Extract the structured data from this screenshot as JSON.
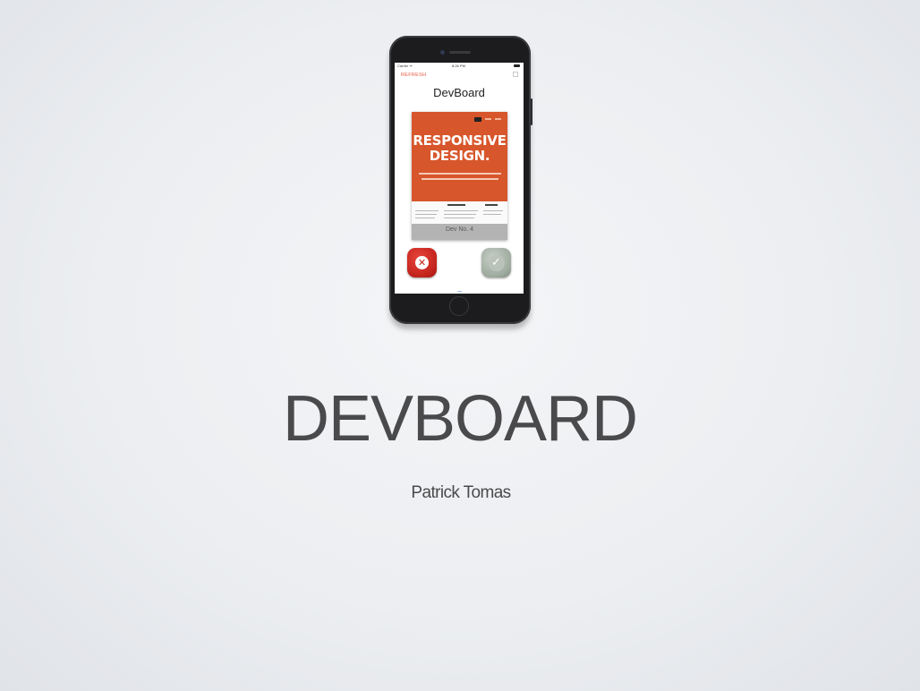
{
  "slide": {
    "title": "DEVBOARD",
    "subtitle": "Patrick Tomas"
  },
  "phone_app": {
    "status_bar": {
      "carrier": "Carrier ᯤ",
      "time": "8:26 PM"
    },
    "refresh_label": "REFRESH",
    "compose_icon": "compose-icon",
    "app_title": "DevBoard",
    "card": {
      "hero_title": "RESPONSIVE DESIGN.",
      "footer_label": "Dev No. 4"
    },
    "reject_icon": "close-icon",
    "reject_glyph": "✕",
    "accept_icon": "checkmark-icon",
    "accept_glyph": "✓"
  },
  "colors": {
    "accent_red": "#e8553f",
    "hero_orange": "#d8562b",
    "reject_red": "#c1231c",
    "accept_gray_green": "#9eaa9e",
    "title_gray": "#4a4a4c"
  }
}
